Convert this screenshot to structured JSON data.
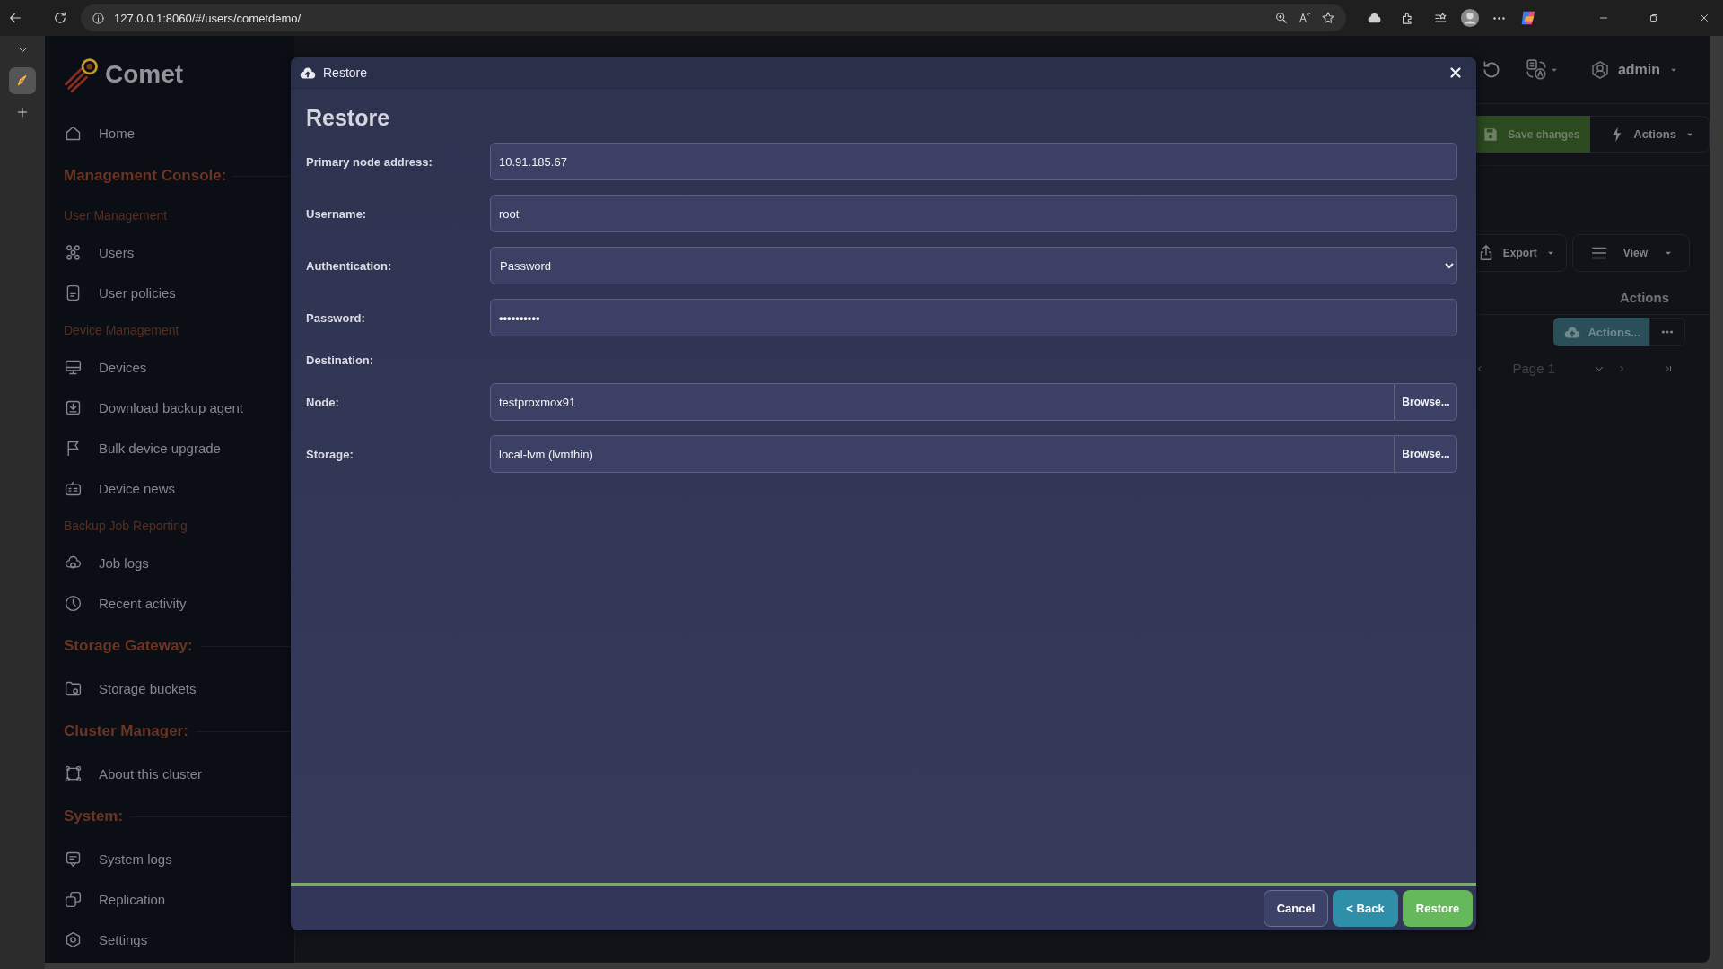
{
  "browser": {
    "url": "127.0.0.1:8060/#/users/cometdemo/"
  },
  "sidebar": {
    "logo": "Comet",
    "items": [
      {
        "kind": "link",
        "label": "Home"
      },
      {
        "kind": "section",
        "label": "Management Console:"
      },
      {
        "kind": "group",
        "label": "User Management"
      },
      {
        "kind": "link",
        "label": "Users"
      },
      {
        "kind": "link",
        "label": "User policies"
      },
      {
        "kind": "group",
        "label": "Device Management"
      },
      {
        "kind": "link",
        "label": "Devices"
      },
      {
        "kind": "link",
        "label": "Download backup agent"
      },
      {
        "kind": "link",
        "label": "Bulk device upgrade"
      },
      {
        "kind": "link",
        "label": "Device news"
      },
      {
        "kind": "group",
        "label": "Backup Job Reporting"
      },
      {
        "kind": "link",
        "label": "Job logs"
      },
      {
        "kind": "link",
        "label": "Recent activity"
      },
      {
        "kind": "section",
        "label": "Storage Gateway:"
      },
      {
        "kind": "link",
        "label": "Storage buckets"
      },
      {
        "kind": "section",
        "label": "Cluster Manager:"
      },
      {
        "kind": "link",
        "label": "About this cluster"
      },
      {
        "kind": "section",
        "label": "System:"
      },
      {
        "kind": "link",
        "label": "System logs"
      },
      {
        "kind": "link",
        "label": "Replication"
      },
      {
        "kind": "link",
        "label": "Settings"
      }
    ]
  },
  "background": {
    "user": "admin",
    "save_button": "Save changes",
    "actions_button": "Actions",
    "export_button": "Export",
    "view_button": "View",
    "column_header": "Actions",
    "row_action": "Actions...",
    "pager": "Page 1"
  },
  "dialog": {
    "header": "Restore",
    "title": "Restore",
    "fields": [
      {
        "kind": "text",
        "label": "Primary node address:",
        "value": "10.91.185.67"
      },
      {
        "kind": "text",
        "label": "Username:",
        "value": "root"
      },
      {
        "kind": "select",
        "label": "Authentication:",
        "value": "Password"
      },
      {
        "kind": "password",
        "label": "Password:",
        "value": "••••••••••"
      },
      {
        "kind": "heading",
        "label": "Destination:"
      },
      {
        "kind": "browse",
        "label": "Node:",
        "value": "testproxmox91",
        "button": "Browse..."
      },
      {
        "kind": "browse",
        "label": "Storage:",
        "value": "local-lvm (lvmthin)",
        "button": "Browse..."
      }
    ],
    "buttons": [
      {
        "kind": "cancel",
        "label": "Cancel"
      },
      {
        "kind": "back",
        "label": "< Back"
      },
      {
        "kind": "primary",
        "label": "Restore"
      }
    ]
  }
}
